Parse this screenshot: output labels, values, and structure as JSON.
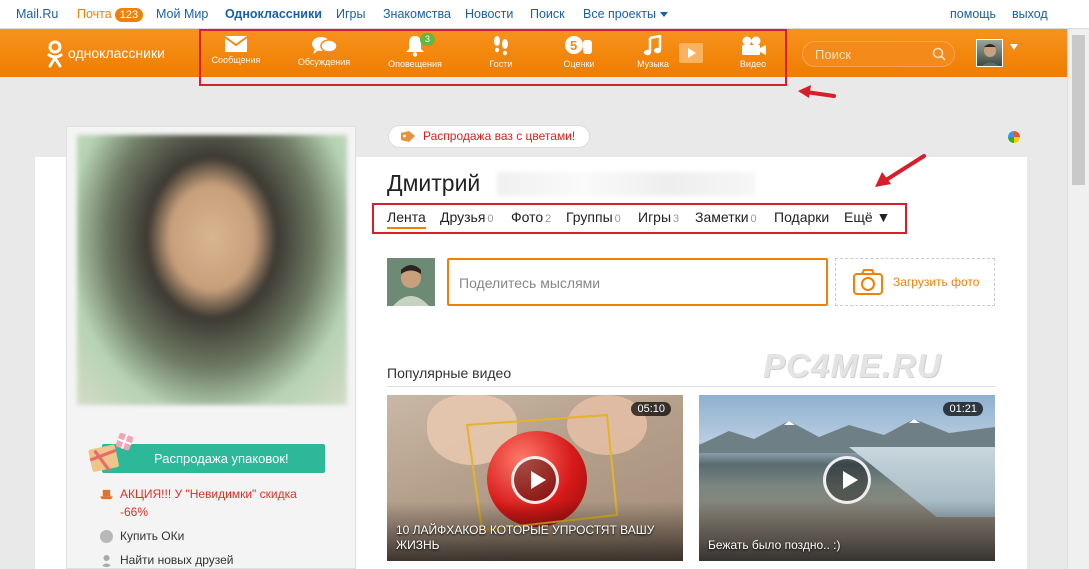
{
  "topbar": {
    "links": [
      {
        "label": "Mail.Ru"
      },
      {
        "label": "Почта",
        "badge": "123"
      },
      {
        "label": "Мой Мир"
      },
      {
        "label": "Одноклассники"
      },
      {
        "label": "Игры"
      },
      {
        "label": "Знакомства"
      },
      {
        "label": "Новости"
      },
      {
        "label": "Поиск"
      },
      {
        "label": "Все проекты"
      }
    ],
    "help": "помощь",
    "logout": "выход"
  },
  "header": {
    "logo_text": "одноклассники",
    "nav": [
      {
        "label": "Сообщения",
        "icon": "envelope-icon"
      },
      {
        "label": "Обсуждения",
        "icon": "chat-bubbles-icon"
      },
      {
        "label": "Оповещения",
        "icon": "bell-icon",
        "badge": "3"
      },
      {
        "label": "Гости",
        "icon": "footprints-icon"
      },
      {
        "label": "Оценки",
        "icon": "rating-icon"
      },
      {
        "label": "Музыка",
        "icon": "music-note-icon"
      },
      {
        "label": "Видео",
        "icon": "video-camera-icon"
      }
    ],
    "search_placeholder": "Поиск"
  },
  "profile": {
    "name": "Дмитрий",
    "sale_banner": "Распродажа ваз с цветами!",
    "tabs": [
      {
        "label": "Лента",
        "count": ""
      },
      {
        "label": "Друзья",
        "count": "0"
      },
      {
        "label": "Фото",
        "count": "2"
      },
      {
        "label": "Группы",
        "count": "0"
      },
      {
        "label": "Игры",
        "count": "3"
      },
      {
        "label": "Заметки",
        "count": "0"
      },
      {
        "label": "Подарки",
        "count": ""
      },
      {
        "label": "Ещё ▼",
        "count": ""
      }
    ],
    "active_tab": "Лента"
  },
  "sidebar": {
    "promo_button": "Распродажа упаковок!",
    "promo_text_line1": "АКЦИЯ!!! У \"Невидимки\" скидка",
    "promo_text_line2": "-66%",
    "buy_ok": "Купить ОКи",
    "find_friends": "Найти новых друзей"
  },
  "composer": {
    "placeholder": "Поделитесь мыслями",
    "upload_label": "Загрузить фото"
  },
  "watermark": "PC4ME.RU",
  "videos": {
    "section_title": "Популярные видео",
    "items": [
      {
        "duration": "05:10",
        "title": "10 ЛАЙФХАКОВ КОТОРЫЕ УПРОСТЯТ ВАШУ ЖИЗНЬ"
      },
      {
        "duration": "01:21",
        "title": "Бежать было поздно.. :)"
      }
    ]
  },
  "colors": {
    "accent": "#ee8208",
    "link": "#1b5fa8",
    "highlight_box": "#d61f2a",
    "promo_green": "#2db89a"
  }
}
